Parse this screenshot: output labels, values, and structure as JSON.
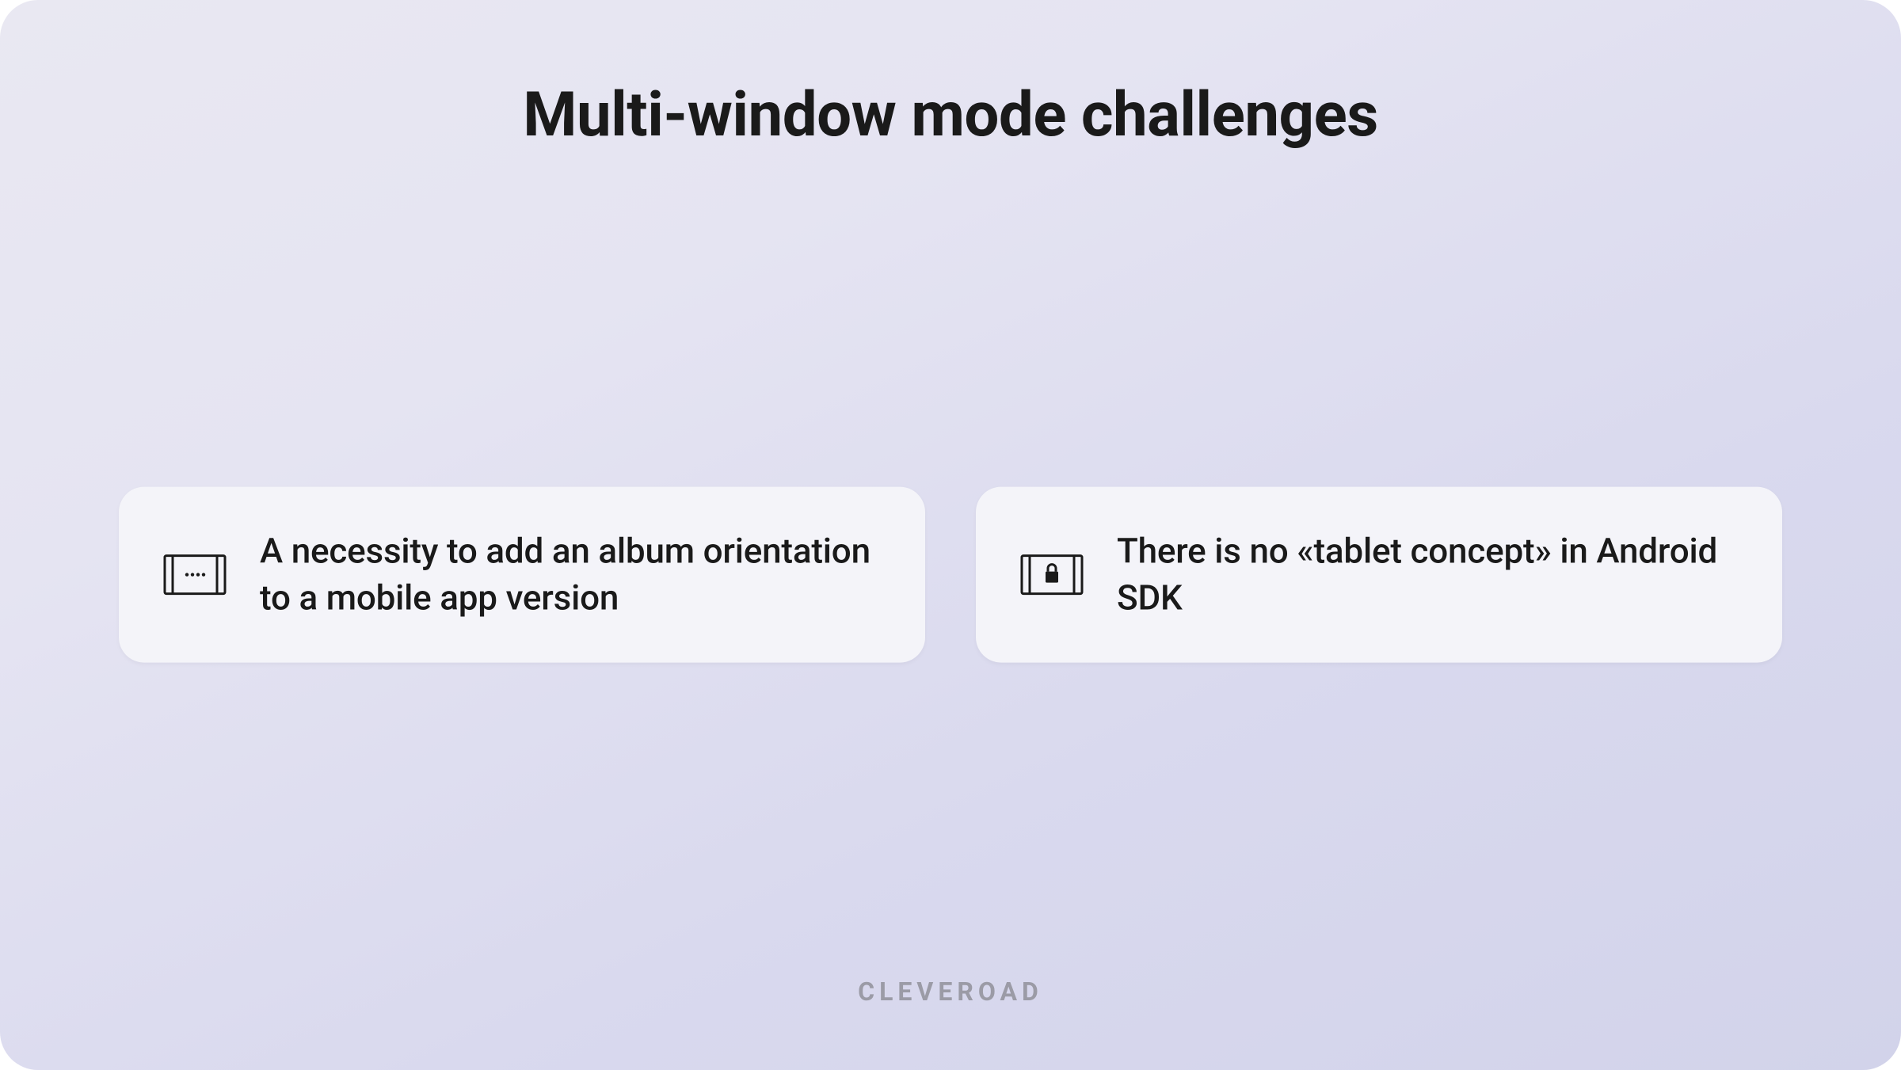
{
  "title": "Multi-window mode challenges",
  "cards": [
    {
      "icon": "text-rows-icon",
      "text": "A necessity to add an album orientation to a mobile app version"
    },
    {
      "icon": "lock-landscape-icon",
      "text": "There is no «tablet concept» in Android SDK"
    }
  ],
  "brand": "CLEVEROAD"
}
